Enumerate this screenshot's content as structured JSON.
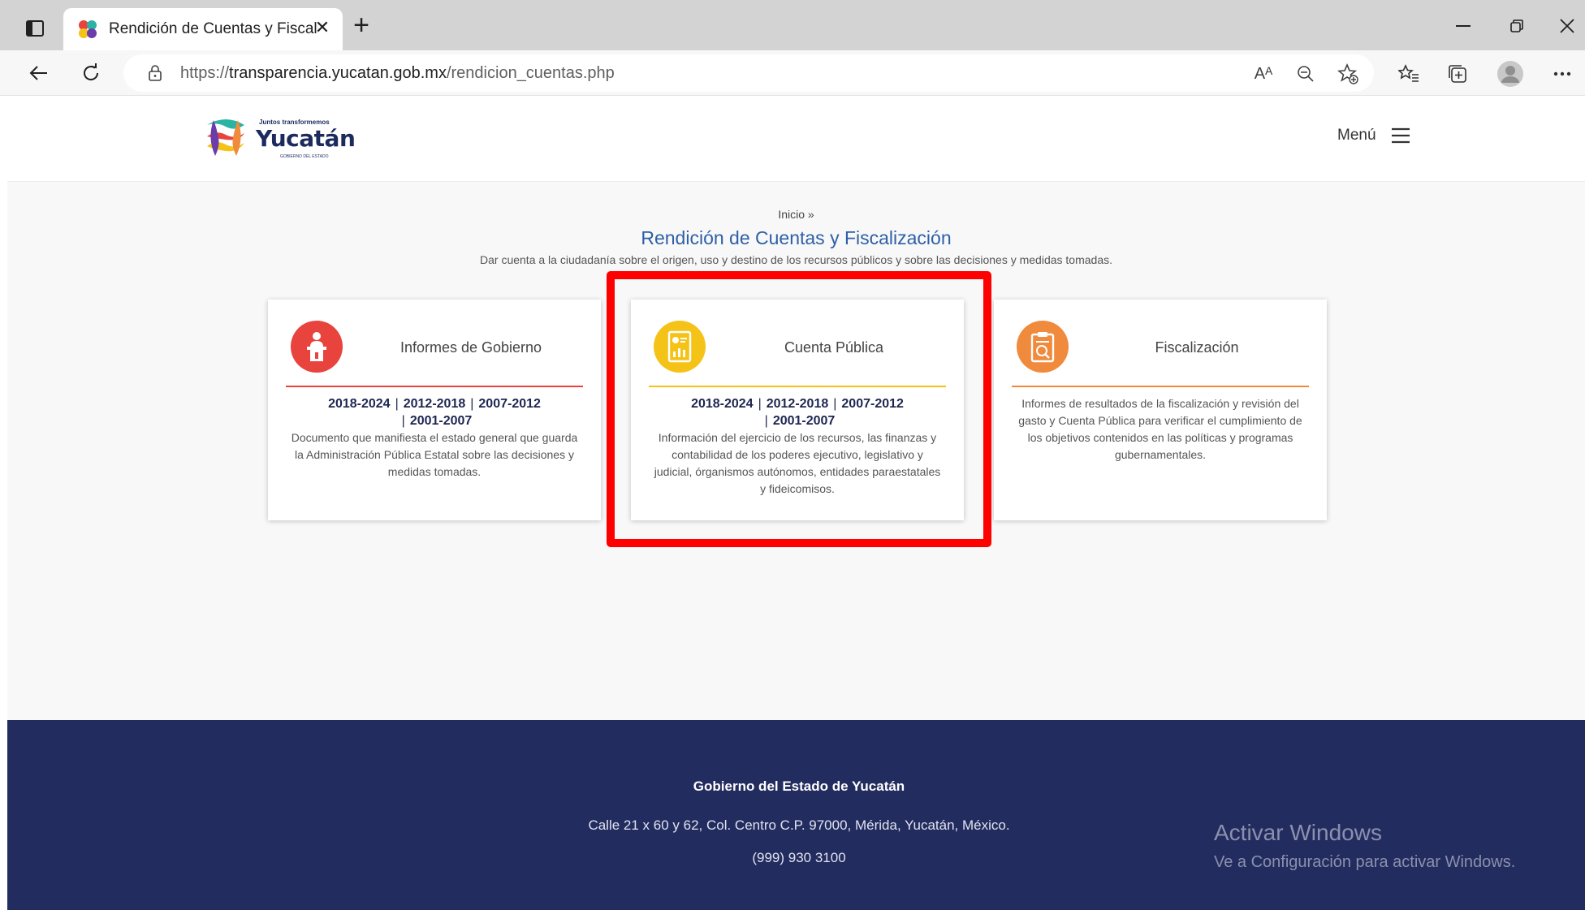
{
  "browser": {
    "tab_title": "Rendición de Cuentas y Fiscalizac",
    "url_scheme": "https://",
    "url_host": "transparencia.yucatan.gob.mx",
    "url_path": "/rendicion_cuentas.php",
    "read_aloud_label": "Aᴬ"
  },
  "header": {
    "logo_tagline": "Juntos transformemos",
    "logo_name": "Yucatán",
    "logo_sub": "GOBIERNO DEL ESTADO",
    "menu_label": "Menú"
  },
  "hero": {
    "breadcrumb": "Inicio »",
    "title": "Rendición de Cuentas y Fiscalización",
    "subtitle": "Dar cuenta a la ciudadanía sobre el origen, uso y destino de los recursos públicos y sobre las decisiones y medidas tomadas."
  },
  "cards": [
    {
      "title": "Informes de Gobierno",
      "years": [
        "2018-2024",
        "2012-2018",
        "2007-2012",
        "2001-2007"
      ],
      "description": "Documento que manifiesta el estado general que guarda la Administración Pública Estatal sobre las decisiones y medidas tomadas.",
      "color": "#e8433d"
    },
    {
      "title": "Cuenta Pública",
      "years": [
        "2018-2024",
        "2012-2018",
        "2007-2012",
        "2001-2007"
      ],
      "description": "Información del ejercicio de los recursos, las finanzas y contabilidad de los poderes ejecutivo, legislativo y judicial, órganismos autónomos, entidades paraestatales y fideicomisos.",
      "color": "#f5c317"
    },
    {
      "title": "Fiscalización",
      "description": "Informes de resultados de la fiscalización y revisión del gasto y Cuenta Pública para verificar el cumplimiento de los objetivos contenidos en las políticas y programas gubernamentales.",
      "color": "#f08a3c"
    }
  ],
  "footer": {
    "title": "Gobierno del Estado de Yucatán",
    "address": "Calle 21 x 60 y 62, Col. Centro C.P. 97000, Mérida, Yucatán, México.",
    "phone": "(999) 930 3100"
  },
  "watermark": {
    "line1": "Activar Windows",
    "line2": "Ve a Configuración para activar Windows."
  },
  "colors": {
    "footer_bg": "#232c5e",
    "title_blue": "#2e5fa8",
    "highlight": "#ff0000"
  }
}
